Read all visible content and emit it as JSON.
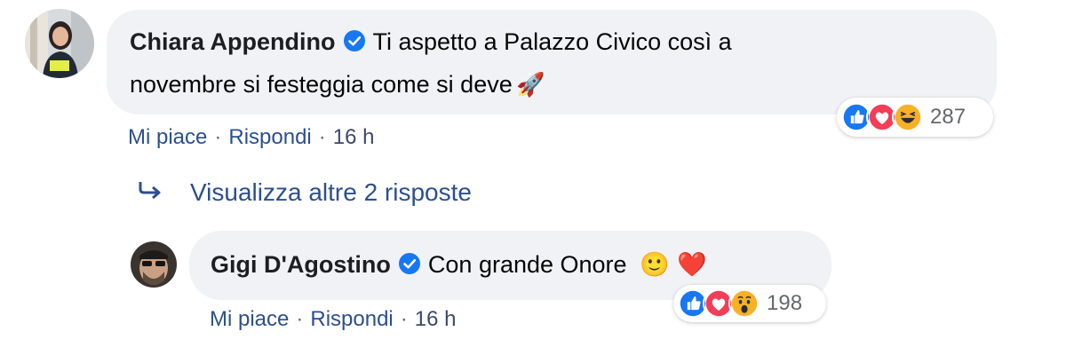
{
  "comment": {
    "author": "Chiara Appendino",
    "text_line1": "Ti aspetto a Palazzo Civico così a",
    "text_line2": "novembre si festeggia come si deve",
    "emoji": "🚀",
    "actions": {
      "like": "Mi piace",
      "reply": "Rispondi",
      "time": "16 h"
    },
    "reactions": {
      "types": [
        "like-icon",
        "love-icon",
        "haha-icon"
      ],
      "count": "287"
    }
  },
  "more_replies": {
    "label": "Visualizza altre 2 risposte",
    "icon": "reply-arrow-icon"
  },
  "reply": {
    "author": "Gigi D'Agostino",
    "text": "Con grande Onore",
    "emojis": [
      "🙂",
      "❤️"
    ],
    "actions": {
      "like": "Mi piace",
      "reply": "Rispondi",
      "time": "16 h"
    },
    "reactions": {
      "types": [
        "like-icon",
        "love-icon",
        "wow-icon"
      ],
      "count": "198"
    }
  },
  "colors": {
    "bubble": "#f0f2f5",
    "link": "#2d4f8e",
    "verified": "#1877f2",
    "like": "#1877f2",
    "love": "#f33e58",
    "haha": "#f7b125"
  }
}
